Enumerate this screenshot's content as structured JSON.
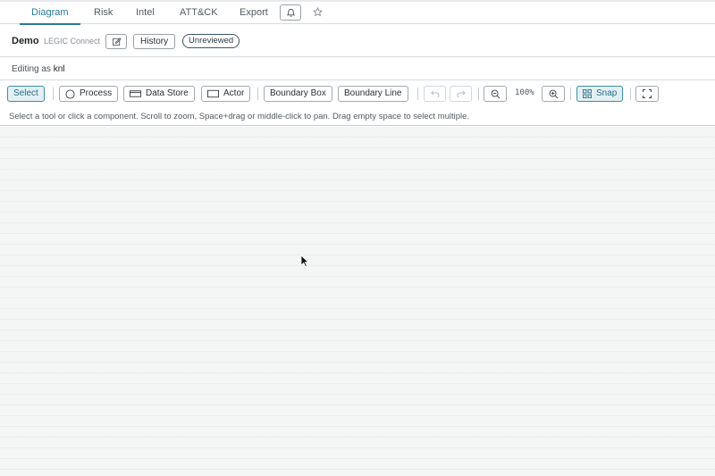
{
  "tabs": [
    {
      "label": "Diagram",
      "active": true
    },
    {
      "label": "Risk",
      "active": false
    },
    {
      "label": "Intel",
      "active": false
    },
    {
      "label": "ATT&CK",
      "active": false
    },
    {
      "label": "Export",
      "active": false
    }
  ],
  "header_icons": {
    "bell": "bell-icon",
    "star": "star-icon"
  },
  "title": {
    "name": "Demo",
    "subtitle": "LEGIC Connect",
    "edit_icon": "edit-icon",
    "history_label": "History",
    "status_badge": "Unreviewed"
  },
  "editing": {
    "prefix": "Editing as",
    "user": "knl"
  },
  "toolbar": {
    "select_label": "Select",
    "process_label": "Process",
    "data_store_label": "Data Store",
    "actor_label": "Actor",
    "boundary_box_label": "Boundary Box",
    "boundary_line_label": "Boundary Line",
    "zoom_level": "100%",
    "snap_label": "Snap",
    "icons": [
      "circle-icon",
      "data-store-icon",
      "actor-icon",
      "undo-icon",
      "redo-icon",
      "zoom-out-icon",
      "zoom-in-icon",
      "grid-icon",
      "fullscreen-icon"
    ]
  },
  "hint": "Select a tool or click a component. Scroll to zoom, Space+drag or middle-click to pan. Drag empty space to select multiple.",
  "colors": {
    "accent": "#2a7a96",
    "canvas_bg": "#f4f6f5"
  }
}
